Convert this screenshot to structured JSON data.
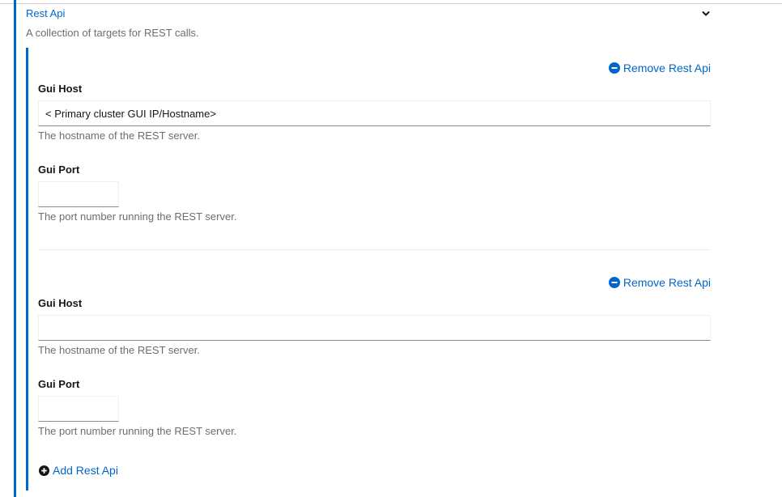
{
  "section": {
    "title": "Rest Api",
    "description": "A collection of targets for REST calls.",
    "expanded_icon": "chevron-down-icon"
  },
  "items": [
    {
      "remove_label": "Remove Rest Api",
      "host_label": "Gui Host",
      "host_value": "< Primary cluster GUI IP/Hostname>",
      "host_helper": "The hostname of the REST server.",
      "port_label": "Gui Port",
      "port_value": "",
      "port_helper": "The port number running the REST server."
    },
    {
      "remove_label": "Remove Rest Api",
      "host_label": "Gui Host",
      "host_value": "",
      "host_helper": "The hostname of the REST server.",
      "port_label": "Gui Port",
      "port_value": "",
      "port_helper": "The port number running the REST server."
    }
  ],
  "add_label": "Add Rest Api",
  "colors": {
    "accent": "#0066cc",
    "muted_text": "#6a6e73",
    "text": "#151515"
  }
}
